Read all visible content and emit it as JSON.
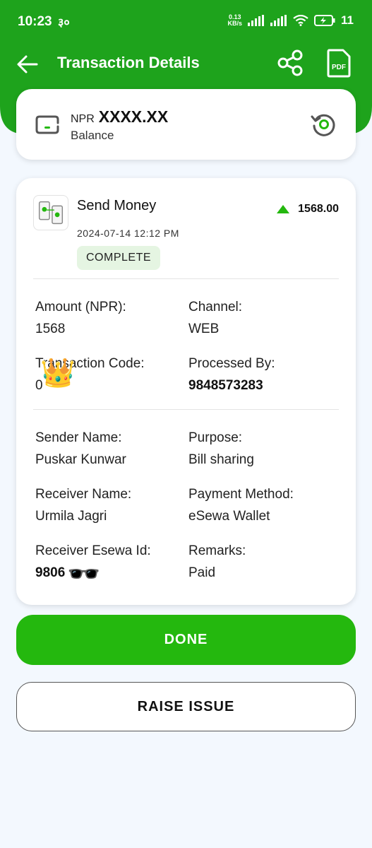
{
  "statusbar": {
    "time": "10:23",
    "extra": "३०",
    "net_speed": "0.13",
    "net_unit": "KB/s",
    "battery": "11"
  },
  "appbar": {
    "title": "Transaction Details",
    "pdf_icon_text": "PDF"
  },
  "balance": {
    "currency": "NPR",
    "amount": "XXXX.XX",
    "label": "Balance"
  },
  "transaction": {
    "service": "Send Money",
    "datetime": "2024-07-14 12:12 PM",
    "status": "COMPLETE",
    "amount": "1568.00",
    "fields": {
      "amount_label": "Amount (NPR):",
      "amount_value": "1568",
      "channel_label": "Channel:",
      "channel_value": "WEB",
      "code_label": "Transaction Code:",
      "code_value": "0",
      "processed_label": "Processed By:",
      "processed_value": "9848573283",
      "sender_label": "Sender Name:",
      "sender_value": "Puskar Kunwar",
      "purpose_label": "Purpose:",
      "purpose_value": "Bill sharing",
      "receiver_label": "Receiver Name:",
      "receiver_value": "Urmila Jagri",
      "method_label": "Payment Method:",
      "method_value": "eSewa Wallet",
      "esewa_id_label": "Receiver Esewa Id:",
      "esewa_id_value": "9806",
      "remarks_label": "Remarks:",
      "remarks_value": "Paid"
    }
  },
  "stickers": {
    "crown": "👑",
    "glasses": "🕶️"
  },
  "buttons": {
    "done": "DONE",
    "raise_issue": "RAISE ISSUE"
  },
  "colors": {
    "brand_green": "#1ea31c",
    "button_green": "#24b80e",
    "badge_bg": "#e5f5e2"
  }
}
